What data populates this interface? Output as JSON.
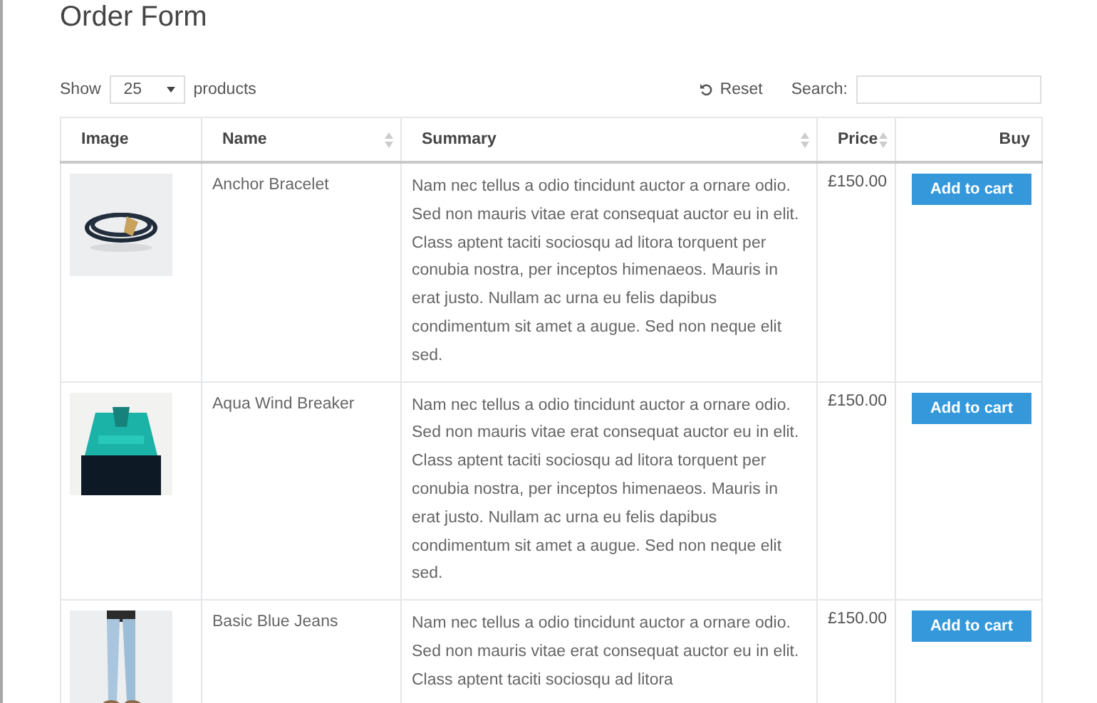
{
  "title": "Order Form",
  "controls": {
    "show_label": "Show",
    "page_size": "25",
    "page_size_suffix": "products",
    "reset": "Reset",
    "search_label": "Search:"
  },
  "table": {
    "columns": [
      {
        "label": "Image",
        "sortable": false
      },
      {
        "label": "Name",
        "sortable": true
      },
      {
        "label": "Summary",
        "sortable": true
      },
      {
        "label": "Price",
        "sortable": true
      },
      {
        "label": "Buy",
        "sortable": false
      }
    ],
    "rows": [
      {
        "name": "Anchor Bracelet",
        "summary": "Nam nec tellus a odio tincidunt auctor a ornare odio. Sed non mauris vitae erat consequat auctor eu in elit. Class aptent taciti sociosqu ad litora torquent per conubia nostra, per inceptos himenaeos. Mauris in erat justo. Nullam ac urna eu felis dapibus condimentum sit amet a augue. Sed non neque elit sed.",
        "price": "£150.00",
        "button": "Add to cart"
      },
      {
        "name": "Aqua Wind Breaker",
        "summary": "Nam nec tellus a odio tincidunt auctor a ornare odio. Sed non mauris vitae erat consequat auctor eu in elit. Class aptent taciti sociosqu ad litora torquent per conubia nostra, per inceptos himenaeos. Mauris in erat justo. Nullam ac urna eu felis dapibus condimentum sit amet a augue. Sed non neque elit sed.",
        "price": "£150.00",
        "button": "Add to cart"
      },
      {
        "name": "Basic Blue Jeans",
        "summary": "Nam nec tellus a odio tincidunt auctor a ornare odio. Sed non mauris vitae erat consequat auctor eu in elit. Class aptent taciti sociosqu ad litora",
        "price": "£150.00",
        "button": "Add to cart"
      }
    ]
  }
}
